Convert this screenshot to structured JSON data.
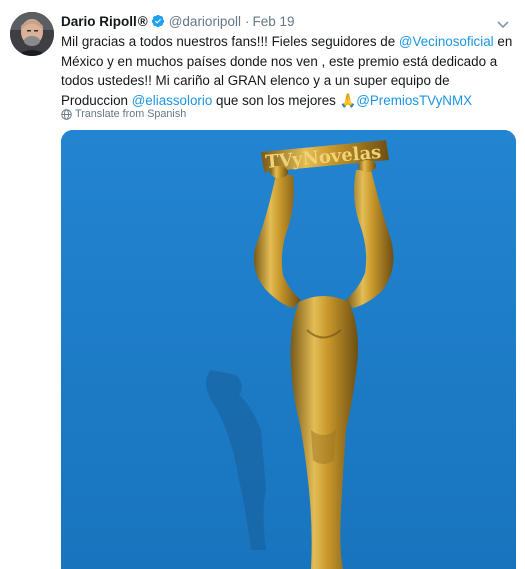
{
  "tweet": {
    "display_name": "Dario Ripoll",
    "name_symbol": "®",
    "handle": "@darioripoll",
    "separator": "·",
    "date": "Feb 19",
    "text_1": "Mil gracias a todos nuestros fans!!! Fieles seguidores de ",
    "mention_1": "@Vecinosoficial",
    "text_2": " en México y en muchos países donde nos ven , este premio está dedicado a todos ustedes!!  Mi cariño al GRAN elenco y a un super  equipo de Produccion ",
    "mention_2": "@eliassolorio",
    "text_3": " que son los mejores ",
    "emoji": "🙏",
    "mention_3": "@PremiosTVyNMX",
    "translate_label": "Translate from Spanish",
    "photo_logo_text": "TVyNovelas"
  },
  "icons": {
    "verified": "verified-badge-icon",
    "menu": "chevron-down-icon",
    "translate": "globe-icon"
  },
  "colors": {
    "link": "#1b95e0",
    "muted": "#657786",
    "text": "#14171a",
    "photo_background": "#1f7fcb",
    "trophy_gold": "#c89a2e"
  }
}
